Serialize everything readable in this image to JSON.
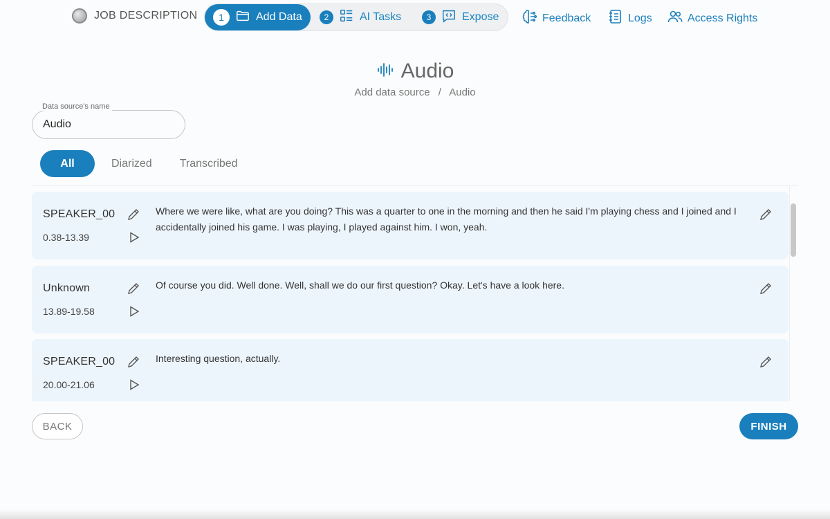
{
  "topnav": {
    "job_label": "JOB DESCRIPTION",
    "steps": [
      {
        "num": "1",
        "label": "Add Data",
        "icon": "folder-icon"
      },
      {
        "num": "2",
        "label": "AI Tasks",
        "icon": "list-icon"
      },
      {
        "num": "3",
        "label": "Expose",
        "icon": "code-chat-icon"
      }
    ],
    "links": [
      {
        "label": "Feedback",
        "icon": "brain-icon"
      },
      {
        "label": "Logs",
        "icon": "notebook-icon"
      },
      {
        "label": "Access Rights",
        "icon": "users-icon"
      }
    ]
  },
  "header": {
    "title": "Audio",
    "title_icon": "audio-wave-icon",
    "breadcrumb": [
      "Add data source",
      "Audio"
    ],
    "breadcrumb_sep": "/"
  },
  "source_name": {
    "label": "Data source's name",
    "value": "Audio"
  },
  "filters": {
    "all": "All",
    "diarized": "Diarized",
    "transcribed": "Transcribed",
    "selected": "All"
  },
  "segments": [
    {
      "speaker": "SPEAKER_00",
      "time": "0.38-13.39",
      "text": "Where we were like, what are you doing? This was a quarter to one in the morning and then he said I'm playing chess and I joined and I accidentally joined his game. I was playing, I played against him. I won, yeah."
    },
    {
      "speaker": "Unknown",
      "time": "13.89-19.58",
      "text": "Of course you did. Well done. Well, shall we do our first question? Okay. Let's have a look here."
    },
    {
      "speaker": "SPEAKER_00",
      "time": "20.00-21.06",
      "text": "Interesting question, actually."
    }
  ],
  "actions": {
    "back": "BACK",
    "finish": "FINISH"
  },
  "colors": {
    "accent": "#1a7fbd",
    "row_bg": "#edf5fc"
  }
}
